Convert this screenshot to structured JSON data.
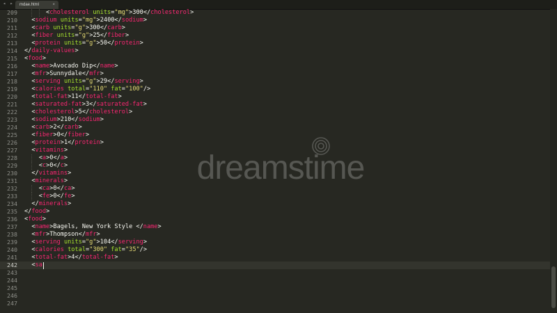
{
  "tab": {
    "title": "mdae.html",
    "close": "×",
    "nav": "◂ ▸"
  },
  "watermark": "dreamstime",
  "active_line": 242,
  "lines": [
    {
      "n": "209",
      "t": [
        [
          "p",
          "      <"
        ],
        [
          "tag",
          "cholesterol"
        ],
        [
          "p",
          " "
        ],
        [
          "attr",
          "units"
        ],
        [
          "p",
          "="
        ],
        [
          "str",
          "\"mg\""
        ],
        [
          "p",
          ">"
        ],
        [
          "txt",
          "300"
        ],
        [
          "p",
          "</"
        ],
        [
          "tag",
          "cholesterol"
        ],
        [
          "p",
          ">"
        ]
      ]
    },
    {
      "n": "210",
      "t": [
        [
          "p",
          "  <"
        ],
        [
          "tag",
          "sodium"
        ],
        [
          "p",
          " "
        ],
        [
          "attr",
          "units"
        ],
        [
          "p",
          "="
        ],
        [
          "str",
          "\"mg\""
        ],
        [
          "p",
          ">"
        ],
        [
          "txt",
          "2400"
        ],
        [
          "p",
          "</"
        ],
        [
          "tag",
          "sodium"
        ],
        [
          "p",
          ">"
        ]
      ]
    },
    {
      "n": "211",
      "t": [
        [
          "p",
          "  <"
        ],
        [
          "tag",
          "carb"
        ],
        [
          "p",
          " "
        ],
        [
          "attr",
          "units"
        ],
        [
          "p",
          "="
        ],
        [
          "str",
          "\"g\""
        ],
        [
          "p",
          ">"
        ],
        [
          "txt",
          "300"
        ],
        [
          "p",
          "</"
        ],
        [
          "tag",
          "carb"
        ],
        [
          "p",
          ">"
        ]
      ]
    },
    {
      "n": "212",
      "t": [
        [
          "p",
          "  <"
        ],
        [
          "tag",
          "fiber"
        ],
        [
          "p",
          " "
        ],
        [
          "attr",
          "units"
        ],
        [
          "p",
          "="
        ],
        [
          "str",
          "\"g\""
        ],
        [
          "p",
          ">"
        ],
        [
          "txt",
          "25"
        ],
        [
          "p",
          "</"
        ],
        [
          "tag",
          "fiber"
        ],
        [
          "p",
          ">"
        ]
      ]
    },
    {
      "n": "213",
      "t": [
        [
          "p",
          "  <"
        ],
        [
          "tag",
          "protein"
        ],
        [
          "p",
          " "
        ],
        [
          "attr",
          "units"
        ],
        [
          "p",
          "="
        ],
        [
          "str",
          "\"g\""
        ],
        [
          "p",
          ">"
        ],
        [
          "txt",
          "50"
        ],
        [
          "p",
          "</"
        ],
        [
          "tag",
          "protein"
        ],
        [
          "p",
          ">"
        ]
      ]
    },
    {
      "n": "214",
      "t": [
        [
          "p",
          "</"
        ],
        [
          "tag",
          "daily-values"
        ],
        [
          "p",
          ">"
        ]
      ]
    },
    {
      "n": "215",
      "t": [
        [
          "p",
          "<"
        ],
        [
          "tag",
          "food"
        ],
        [
          "p",
          ">"
        ]
      ]
    },
    {
      "n": "216",
      "t": [
        [
          "p",
          "  <"
        ],
        [
          "tag",
          "name"
        ],
        [
          "p",
          ">"
        ],
        [
          "txt",
          "Avocado Dip"
        ],
        [
          "p",
          "</"
        ],
        [
          "tag",
          "name"
        ],
        [
          "p",
          ">"
        ]
      ]
    },
    {
      "n": "217",
      "t": [
        [
          "p",
          "  <"
        ],
        [
          "tag",
          "mfr"
        ],
        [
          "p",
          ">"
        ],
        [
          "txt",
          "Sunnydale"
        ],
        [
          "p",
          "</"
        ],
        [
          "tag",
          "mfr"
        ],
        [
          "p",
          ">"
        ]
      ]
    },
    {
      "n": "218",
      "t": [
        [
          "p",
          "  <"
        ],
        [
          "tag",
          "serving"
        ],
        [
          "p",
          " "
        ],
        [
          "attr",
          "units"
        ],
        [
          "p",
          "="
        ],
        [
          "str",
          "\"g\""
        ],
        [
          "p",
          ">"
        ],
        [
          "txt",
          "29"
        ],
        [
          "p",
          "</"
        ],
        [
          "tag",
          "serving"
        ],
        [
          "p",
          ">"
        ]
      ]
    },
    {
      "n": "219",
      "t": [
        [
          "p",
          "  <"
        ],
        [
          "tag",
          "calories"
        ],
        [
          "p",
          " "
        ],
        [
          "attr",
          "total"
        ],
        [
          "p",
          "="
        ],
        [
          "str",
          "\"110\""
        ],
        [
          "p",
          " "
        ],
        [
          "attr",
          "fat"
        ],
        [
          "p",
          "="
        ],
        [
          "str",
          "\"100\""
        ],
        [
          "p",
          "/>"
        ]
      ]
    },
    {
      "n": "220",
      "t": [
        [
          "p",
          "  <"
        ],
        [
          "tag",
          "total-fat"
        ],
        [
          "p",
          ">"
        ],
        [
          "txt",
          "11"
        ],
        [
          "p",
          "</"
        ],
        [
          "tag",
          "total-fat"
        ],
        [
          "p",
          ">"
        ]
      ]
    },
    {
      "n": "221",
      "t": [
        [
          "p",
          "  <"
        ],
        [
          "tag",
          "saturated-fat"
        ],
        [
          "p",
          ">"
        ],
        [
          "txt",
          "3"
        ],
        [
          "p",
          "</"
        ],
        [
          "tag",
          "saturated-fat"
        ],
        [
          "p",
          ">"
        ]
      ]
    },
    {
      "n": "222",
      "t": [
        [
          "p",
          "  <"
        ],
        [
          "tag",
          "cholesterol"
        ],
        [
          "p",
          ">"
        ],
        [
          "txt",
          "5"
        ],
        [
          "p",
          "</"
        ],
        [
          "tag",
          "cholesterol"
        ],
        [
          "p",
          ">"
        ]
      ]
    },
    {
      "n": "223",
      "t": [
        [
          "p",
          "  <"
        ],
        [
          "tag",
          "sodium"
        ],
        [
          "p",
          ">"
        ],
        [
          "txt",
          "210"
        ],
        [
          "p",
          "</"
        ],
        [
          "tag",
          "sodium"
        ],
        [
          "p",
          ">"
        ]
      ]
    },
    {
      "n": "224",
      "t": [
        [
          "p",
          "  <"
        ],
        [
          "tag",
          "carb"
        ],
        [
          "p",
          ">"
        ],
        [
          "txt",
          "2"
        ],
        [
          "p",
          "</"
        ],
        [
          "tag",
          "carb"
        ],
        [
          "p",
          ">"
        ]
      ]
    },
    {
      "n": "225",
      "t": [
        [
          "p",
          "  <"
        ],
        [
          "tag",
          "fiber"
        ],
        [
          "p",
          ">"
        ],
        [
          "txt",
          "0"
        ],
        [
          "p",
          "</"
        ],
        [
          "tag",
          "fiber"
        ],
        [
          "p",
          ">"
        ]
      ]
    },
    {
      "n": "226",
      "t": [
        [
          "p",
          "  <"
        ],
        [
          "tag",
          "protein"
        ],
        [
          "p",
          ">"
        ],
        [
          "txt",
          "1"
        ],
        [
          "p",
          "</"
        ],
        [
          "tag",
          "protein"
        ],
        [
          "p",
          ">"
        ]
      ]
    },
    {
      "n": "227",
      "t": [
        [
          "p",
          "  <"
        ],
        [
          "tag",
          "vitamins"
        ],
        [
          "p",
          ">"
        ]
      ]
    },
    {
      "n": "228",
      "t": [
        [
          "p",
          "    <"
        ],
        [
          "tag",
          "a"
        ],
        [
          "p",
          ">"
        ],
        [
          "txt",
          "0"
        ],
        [
          "p",
          "</"
        ],
        [
          "tag",
          "a"
        ],
        [
          "p",
          ">"
        ]
      ]
    },
    {
      "n": "229",
      "t": [
        [
          "p",
          "    <"
        ],
        [
          "tag",
          "c"
        ],
        [
          "p",
          ">"
        ],
        [
          "txt",
          "0"
        ],
        [
          "p",
          "</"
        ],
        [
          "tag",
          "c"
        ],
        [
          "p",
          ">"
        ]
      ]
    },
    {
      "n": "230",
      "t": [
        [
          "p",
          "  </"
        ],
        [
          "tag",
          "vitamins"
        ],
        [
          "p",
          ">"
        ]
      ]
    },
    {
      "n": "231",
      "t": [
        [
          "p",
          "  <"
        ],
        [
          "tag",
          "minerals"
        ],
        [
          "p",
          ">"
        ]
      ]
    },
    {
      "n": "232",
      "t": [
        [
          "p",
          "    <"
        ],
        [
          "tag",
          "ca"
        ],
        [
          "p",
          ">"
        ],
        [
          "txt",
          "0"
        ],
        [
          "p",
          "</"
        ],
        [
          "tag",
          "ca"
        ],
        [
          "p",
          ">"
        ]
      ]
    },
    {
      "n": "233",
      "t": [
        [
          "p",
          "    <"
        ],
        [
          "tag",
          "fe"
        ],
        [
          "p",
          ">"
        ],
        [
          "txt",
          "0"
        ],
        [
          "p",
          "</"
        ],
        [
          "tag",
          "fe"
        ],
        [
          "p",
          ">"
        ]
      ]
    },
    {
      "n": "234",
      "t": [
        [
          "p",
          "  </"
        ],
        [
          "tag",
          "minerals"
        ],
        [
          "p",
          ">"
        ]
      ]
    },
    {
      "n": "235",
      "t": [
        [
          "p",
          "</"
        ],
        [
          "tag",
          "food"
        ],
        [
          "p",
          ">"
        ]
      ]
    },
    {
      "n": "236",
      "t": [
        [
          "p",
          "<"
        ],
        [
          "tag",
          "food"
        ],
        [
          "p",
          ">"
        ]
      ]
    },
    {
      "n": "237",
      "t": [
        [
          "p",
          "  <"
        ],
        [
          "tag",
          "name"
        ],
        [
          "p",
          ">"
        ],
        [
          "txt",
          "Bagels, New York Style "
        ],
        [
          "p",
          "</"
        ],
        [
          "tag",
          "name"
        ],
        [
          "p",
          ">"
        ]
      ]
    },
    {
      "n": "238",
      "t": [
        [
          "p",
          "  <"
        ],
        [
          "tag",
          "mfr"
        ],
        [
          "p",
          ">"
        ],
        [
          "txt",
          "Thompson"
        ],
        [
          "p",
          "</"
        ],
        [
          "tag",
          "mfr"
        ],
        [
          "p",
          ">"
        ]
      ]
    },
    {
      "n": "239",
      "t": [
        [
          "p",
          "  <"
        ],
        [
          "tag",
          "serving"
        ],
        [
          "p",
          " "
        ],
        [
          "attr",
          "units"
        ],
        [
          "p",
          "="
        ],
        [
          "str",
          "\"g\""
        ],
        [
          "p",
          ">"
        ],
        [
          "txt",
          "104"
        ],
        [
          "p",
          "</"
        ],
        [
          "tag",
          "serving"
        ],
        [
          "p",
          ">"
        ]
      ]
    },
    {
      "n": "240",
      "t": [
        [
          "p",
          "  <"
        ],
        [
          "tag",
          "calories"
        ],
        [
          "p",
          " "
        ],
        [
          "attr",
          "total"
        ],
        [
          "p",
          "="
        ],
        [
          "str",
          "\"300\""
        ],
        [
          "p",
          " "
        ],
        [
          "attr",
          "fat"
        ],
        [
          "p",
          "="
        ],
        [
          "str",
          "\"35\""
        ],
        [
          "p",
          "/>"
        ]
      ]
    },
    {
      "n": "241",
      "t": [
        [
          "p",
          "  <"
        ],
        [
          "tag",
          "total-fat"
        ],
        [
          "p",
          ">"
        ],
        [
          "txt",
          "4"
        ],
        [
          "p",
          "</"
        ],
        [
          "tag",
          "total-fat"
        ],
        [
          "p",
          ">"
        ]
      ]
    },
    {
      "n": "242",
      "t": [
        [
          "p",
          "  <"
        ],
        [
          "tag",
          "sa"
        ]
      ]
    },
    {
      "n": "243",
      "t": []
    },
    {
      "n": "244",
      "t": []
    },
    {
      "n": "245",
      "t": []
    },
    {
      "n": "246",
      "t": []
    },
    {
      "n": "247",
      "t": []
    }
  ]
}
